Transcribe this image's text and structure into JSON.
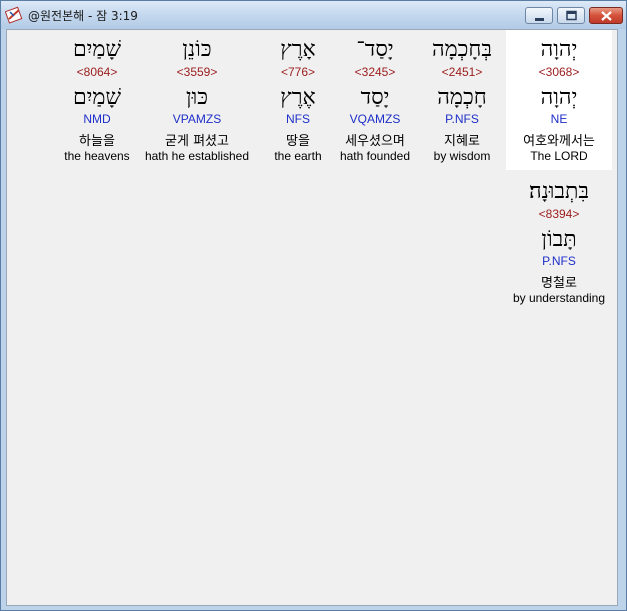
{
  "window": {
    "title": "@원전본해 - 잠 3:19"
  },
  "controls": {
    "minimize": "minimize-icon",
    "maximize": "maximize-icon",
    "close": "close-icon"
  },
  "words": [
    {
      "hebrew": "יְהוָה",
      "strongs": "<3068>",
      "lemma": "יְהוָה",
      "morph": "NE",
      "korean": "여호와께서는",
      "english": "The LORD",
      "selected": true
    },
    {
      "hebrew": "בְּחָכְמָה",
      "strongs": "<2451>",
      "lemma": "חָכְמָה",
      "morph": "P.NFS",
      "korean": "지혜로",
      "english": "by wisdom",
      "selected": false
    },
    {
      "hebrew": "יָסַד־",
      "strongs": "<3245>",
      "lemma": "יָסַד",
      "morph": "VQAMZS",
      "korean": "세우셨으며",
      "english": "hath founded",
      "selected": false
    },
    {
      "hebrew": "אָרֶץ",
      "strongs": "<776>",
      "lemma": "אֶרֶץ",
      "morph": "NFS",
      "korean": "땅을",
      "english": "the earth",
      "selected": false
    },
    {
      "hebrew": "כּוֹנֵן",
      "strongs": "<3559>",
      "lemma": "כּוּן",
      "morph": "VPAMZS",
      "korean": "굳게 펴셨고",
      "english": "hath he established",
      "selected": false
    },
    {
      "hebrew": "שָׁמַיִם",
      "strongs": "<8064>",
      "lemma": "שָׁמַיִם",
      "morph": "NMD",
      "korean": "하늘을",
      "english": "the heavens",
      "selected": false
    },
    {
      "hebrew": "בִּתְבוּנָה׃",
      "strongs": "<8394>",
      "lemma": "תָּבוֹן",
      "morph": "P.NFS",
      "korean": "명철로",
      "english": "by understanding",
      "selected": false
    }
  ]
}
